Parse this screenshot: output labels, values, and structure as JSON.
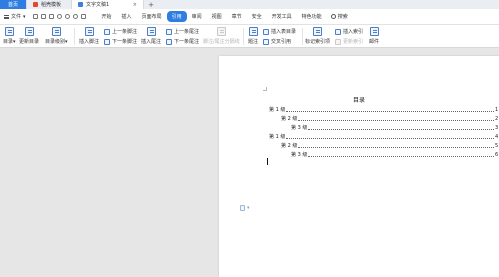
{
  "tabs": {
    "home": "首页",
    "template": "稻壳模板",
    "document": "文字文稿1",
    "close_glyph": "×",
    "add_glyph": "+"
  },
  "menubar": {
    "file_label": "文件",
    "file_caret": "▾",
    "items": [
      "开始",
      "插入",
      "页面布局",
      "引用",
      "审阅",
      "视图",
      "章节",
      "安全",
      "开发工具",
      "特色功能"
    ],
    "active_index": 3,
    "search_label": "搜索"
  },
  "ribbon": {
    "toc": "目录▾",
    "update_toc": "更新目录",
    "toc_level": "目录级别▾",
    "insert_footnote": "插入脚注",
    "prev_footnote": "上一条脚注",
    "next_footnote": "下一条脚注",
    "insert_endnote": "插入尾注",
    "prev_endnote": "上一条尾注",
    "next_endnote": "下一条尾注",
    "footnote_separator": "脚注/尾注分隔线",
    "caption": "题注",
    "insert_table_of_figures": "插入表目录",
    "cross_reference": "交叉引用",
    "mark_index": "标记索引项",
    "insert_index": "插入索引",
    "update_index": "更新索引",
    "mail": "邮件"
  },
  "document": {
    "toc_title": "目录",
    "toc_entries": [
      {
        "label": "第 1 级",
        "page": "1"
      },
      {
        "label": "第 2 级",
        "page": "2"
      },
      {
        "label": "第 3 级",
        "page": "3"
      },
      {
        "label": "第 1 级",
        "page": "4"
      },
      {
        "label": "第 2 级",
        "page": "5"
      },
      {
        "label": "第 3 级",
        "page": "6"
      }
    ]
  },
  "colors": {
    "accent": "#2f7de1",
    "template_icon": "#e8452c",
    "doc_icon": "#3d7fe0"
  }
}
